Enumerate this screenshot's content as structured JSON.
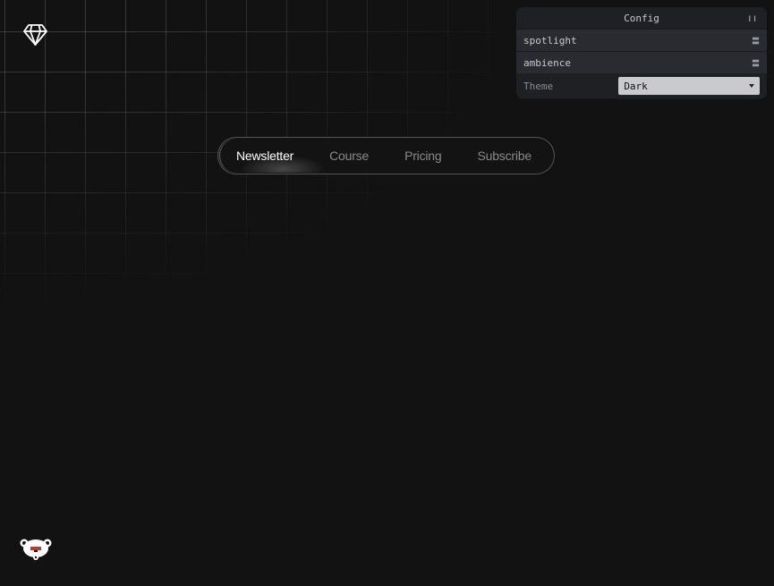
{
  "nav": {
    "items": [
      {
        "label": "Newsletter",
        "active": true
      },
      {
        "label": "Course",
        "active": false
      },
      {
        "label": "Pricing",
        "active": false
      },
      {
        "label": "Subscribe",
        "active": false
      }
    ]
  },
  "config": {
    "title": "Config",
    "folders": [
      {
        "label": "spotlight"
      },
      {
        "label": "ambience"
      }
    ],
    "theme": {
      "label": "Theme",
      "value": "Dark"
    }
  },
  "icons": {
    "logo": "diamond-icon",
    "mascot": "bear-mascot-icon"
  },
  "colors": {
    "background": "#121212",
    "active_text": "#ffffff",
    "inactive_text": "#8a8a8a"
  }
}
